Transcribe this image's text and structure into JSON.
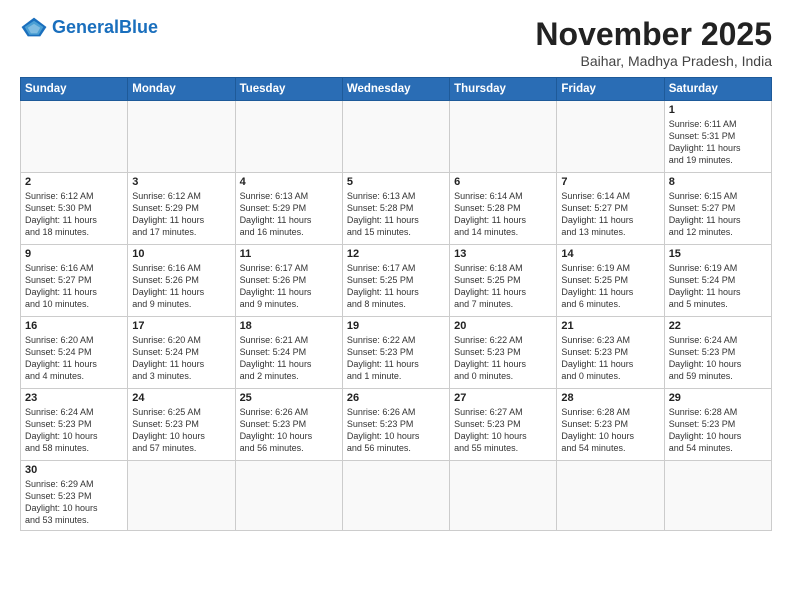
{
  "header": {
    "logo_text_general": "General",
    "logo_text_blue": "Blue",
    "month_year": "November 2025",
    "location": "Baihar, Madhya Pradesh, India"
  },
  "weekdays": [
    "Sunday",
    "Monday",
    "Tuesday",
    "Wednesday",
    "Thursday",
    "Friday",
    "Saturday"
  ],
  "weeks": [
    [
      {
        "day": "",
        "info": ""
      },
      {
        "day": "",
        "info": ""
      },
      {
        "day": "",
        "info": ""
      },
      {
        "day": "",
        "info": ""
      },
      {
        "day": "",
        "info": ""
      },
      {
        "day": "",
        "info": ""
      },
      {
        "day": "1",
        "info": "Sunrise: 6:11 AM\nSunset: 5:31 PM\nDaylight: 11 hours\nand 19 minutes."
      }
    ],
    [
      {
        "day": "2",
        "info": "Sunrise: 6:12 AM\nSunset: 5:30 PM\nDaylight: 11 hours\nand 18 minutes."
      },
      {
        "day": "3",
        "info": "Sunrise: 6:12 AM\nSunset: 5:29 PM\nDaylight: 11 hours\nand 17 minutes."
      },
      {
        "day": "4",
        "info": "Sunrise: 6:13 AM\nSunset: 5:29 PM\nDaylight: 11 hours\nand 16 minutes."
      },
      {
        "day": "5",
        "info": "Sunrise: 6:13 AM\nSunset: 5:28 PM\nDaylight: 11 hours\nand 15 minutes."
      },
      {
        "day": "6",
        "info": "Sunrise: 6:14 AM\nSunset: 5:28 PM\nDaylight: 11 hours\nand 14 minutes."
      },
      {
        "day": "7",
        "info": "Sunrise: 6:14 AM\nSunset: 5:27 PM\nDaylight: 11 hours\nand 13 minutes."
      },
      {
        "day": "8",
        "info": "Sunrise: 6:15 AM\nSunset: 5:27 PM\nDaylight: 11 hours\nand 12 minutes."
      }
    ],
    [
      {
        "day": "9",
        "info": "Sunrise: 6:16 AM\nSunset: 5:27 PM\nDaylight: 11 hours\nand 10 minutes."
      },
      {
        "day": "10",
        "info": "Sunrise: 6:16 AM\nSunset: 5:26 PM\nDaylight: 11 hours\nand 9 minutes."
      },
      {
        "day": "11",
        "info": "Sunrise: 6:17 AM\nSunset: 5:26 PM\nDaylight: 11 hours\nand 9 minutes."
      },
      {
        "day": "12",
        "info": "Sunrise: 6:17 AM\nSunset: 5:25 PM\nDaylight: 11 hours\nand 8 minutes."
      },
      {
        "day": "13",
        "info": "Sunrise: 6:18 AM\nSunset: 5:25 PM\nDaylight: 11 hours\nand 7 minutes."
      },
      {
        "day": "14",
        "info": "Sunrise: 6:19 AM\nSunset: 5:25 PM\nDaylight: 11 hours\nand 6 minutes."
      },
      {
        "day": "15",
        "info": "Sunrise: 6:19 AM\nSunset: 5:24 PM\nDaylight: 11 hours\nand 5 minutes."
      }
    ],
    [
      {
        "day": "16",
        "info": "Sunrise: 6:20 AM\nSunset: 5:24 PM\nDaylight: 11 hours\nand 4 minutes."
      },
      {
        "day": "17",
        "info": "Sunrise: 6:20 AM\nSunset: 5:24 PM\nDaylight: 11 hours\nand 3 minutes."
      },
      {
        "day": "18",
        "info": "Sunrise: 6:21 AM\nSunset: 5:24 PM\nDaylight: 11 hours\nand 2 minutes."
      },
      {
        "day": "19",
        "info": "Sunrise: 6:22 AM\nSunset: 5:23 PM\nDaylight: 11 hours\nand 1 minute."
      },
      {
        "day": "20",
        "info": "Sunrise: 6:22 AM\nSunset: 5:23 PM\nDaylight: 11 hours\nand 0 minutes."
      },
      {
        "day": "21",
        "info": "Sunrise: 6:23 AM\nSunset: 5:23 PM\nDaylight: 11 hours\nand 0 minutes."
      },
      {
        "day": "22",
        "info": "Sunrise: 6:24 AM\nSunset: 5:23 PM\nDaylight: 10 hours\nand 59 minutes."
      }
    ],
    [
      {
        "day": "23",
        "info": "Sunrise: 6:24 AM\nSunset: 5:23 PM\nDaylight: 10 hours\nand 58 minutes."
      },
      {
        "day": "24",
        "info": "Sunrise: 6:25 AM\nSunset: 5:23 PM\nDaylight: 10 hours\nand 57 minutes."
      },
      {
        "day": "25",
        "info": "Sunrise: 6:26 AM\nSunset: 5:23 PM\nDaylight: 10 hours\nand 56 minutes."
      },
      {
        "day": "26",
        "info": "Sunrise: 6:26 AM\nSunset: 5:23 PM\nDaylight: 10 hours\nand 56 minutes."
      },
      {
        "day": "27",
        "info": "Sunrise: 6:27 AM\nSunset: 5:23 PM\nDaylight: 10 hours\nand 55 minutes."
      },
      {
        "day": "28",
        "info": "Sunrise: 6:28 AM\nSunset: 5:23 PM\nDaylight: 10 hours\nand 54 minutes."
      },
      {
        "day": "29",
        "info": "Sunrise: 6:28 AM\nSunset: 5:23 PM\nDaylight: 10 hours\nand 54 minutes."
      }
    ],
    [
      {
        "day": "30",
        "info": "Sunrise: 6:29 AM\nSunset: 5:23 PM\nDaylight: 10 hours\nand 53 minutes."
      },
      {
        "day": "",
        "info": ""
      },
      {
        "day": "",
        "info": ""
      },
      {
        "day": "",
        "info": ""
      },
      {
        "day": "",
        "info": ""
      },
      {
        "day": "",
        "info": ""
      },
      {
        "day": "",
        "info": ""
      }
    ]
  ]
}
